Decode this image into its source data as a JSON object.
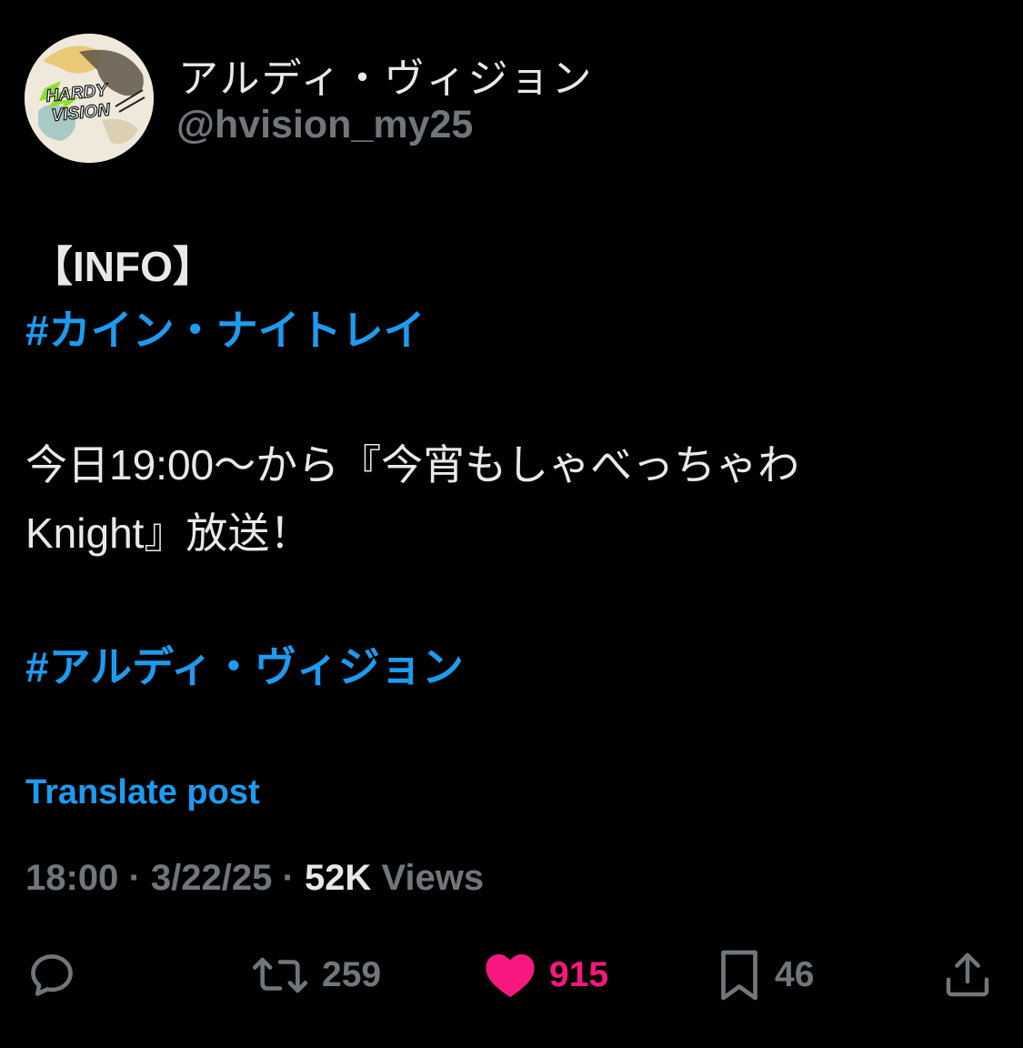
{
  "author": {
    "display_name": "アルディ・ヴィジョン",
    "handle": "@hvision_my25",
    "avatar_logo_text": "HARDY VISION"
  },
  "post": {
    "line1": "【INFO】",
    "hashtag1": "#カイン・ナイトレイ",
    "line3": "今日19:00〜から『今宵もしゃべっちゃわ",
    "line4": "Knight』放送！",
    "hashtag2": "#アルディ・ヴィジョン"
  },
  "translate_label": "Translate post",
  "meta": {
    "time": "18:00",
    "separator": "·",
    "date": "3/22/25",
    "views_count": "52K",
    "views_label": "Views"
  },
  "actions": {
    "reply_icon": "reply-icon",
    "repost_icon": "repost-icon",
    "repost_count": "259",
    "like_icon": "heart-icon",
    "like_count": "915",
    "bookmark_icon": "bookmark-icon",
    "bookmark_count": "46",
    "share_icon": "share-icon"
  },
  "colors": {
    "background": "#000000",
    "text": "#e7e9ea",
    "muted": "#71767b",
    "link": "#1d9bf0",
    "like": "#f91880"
  }
}
